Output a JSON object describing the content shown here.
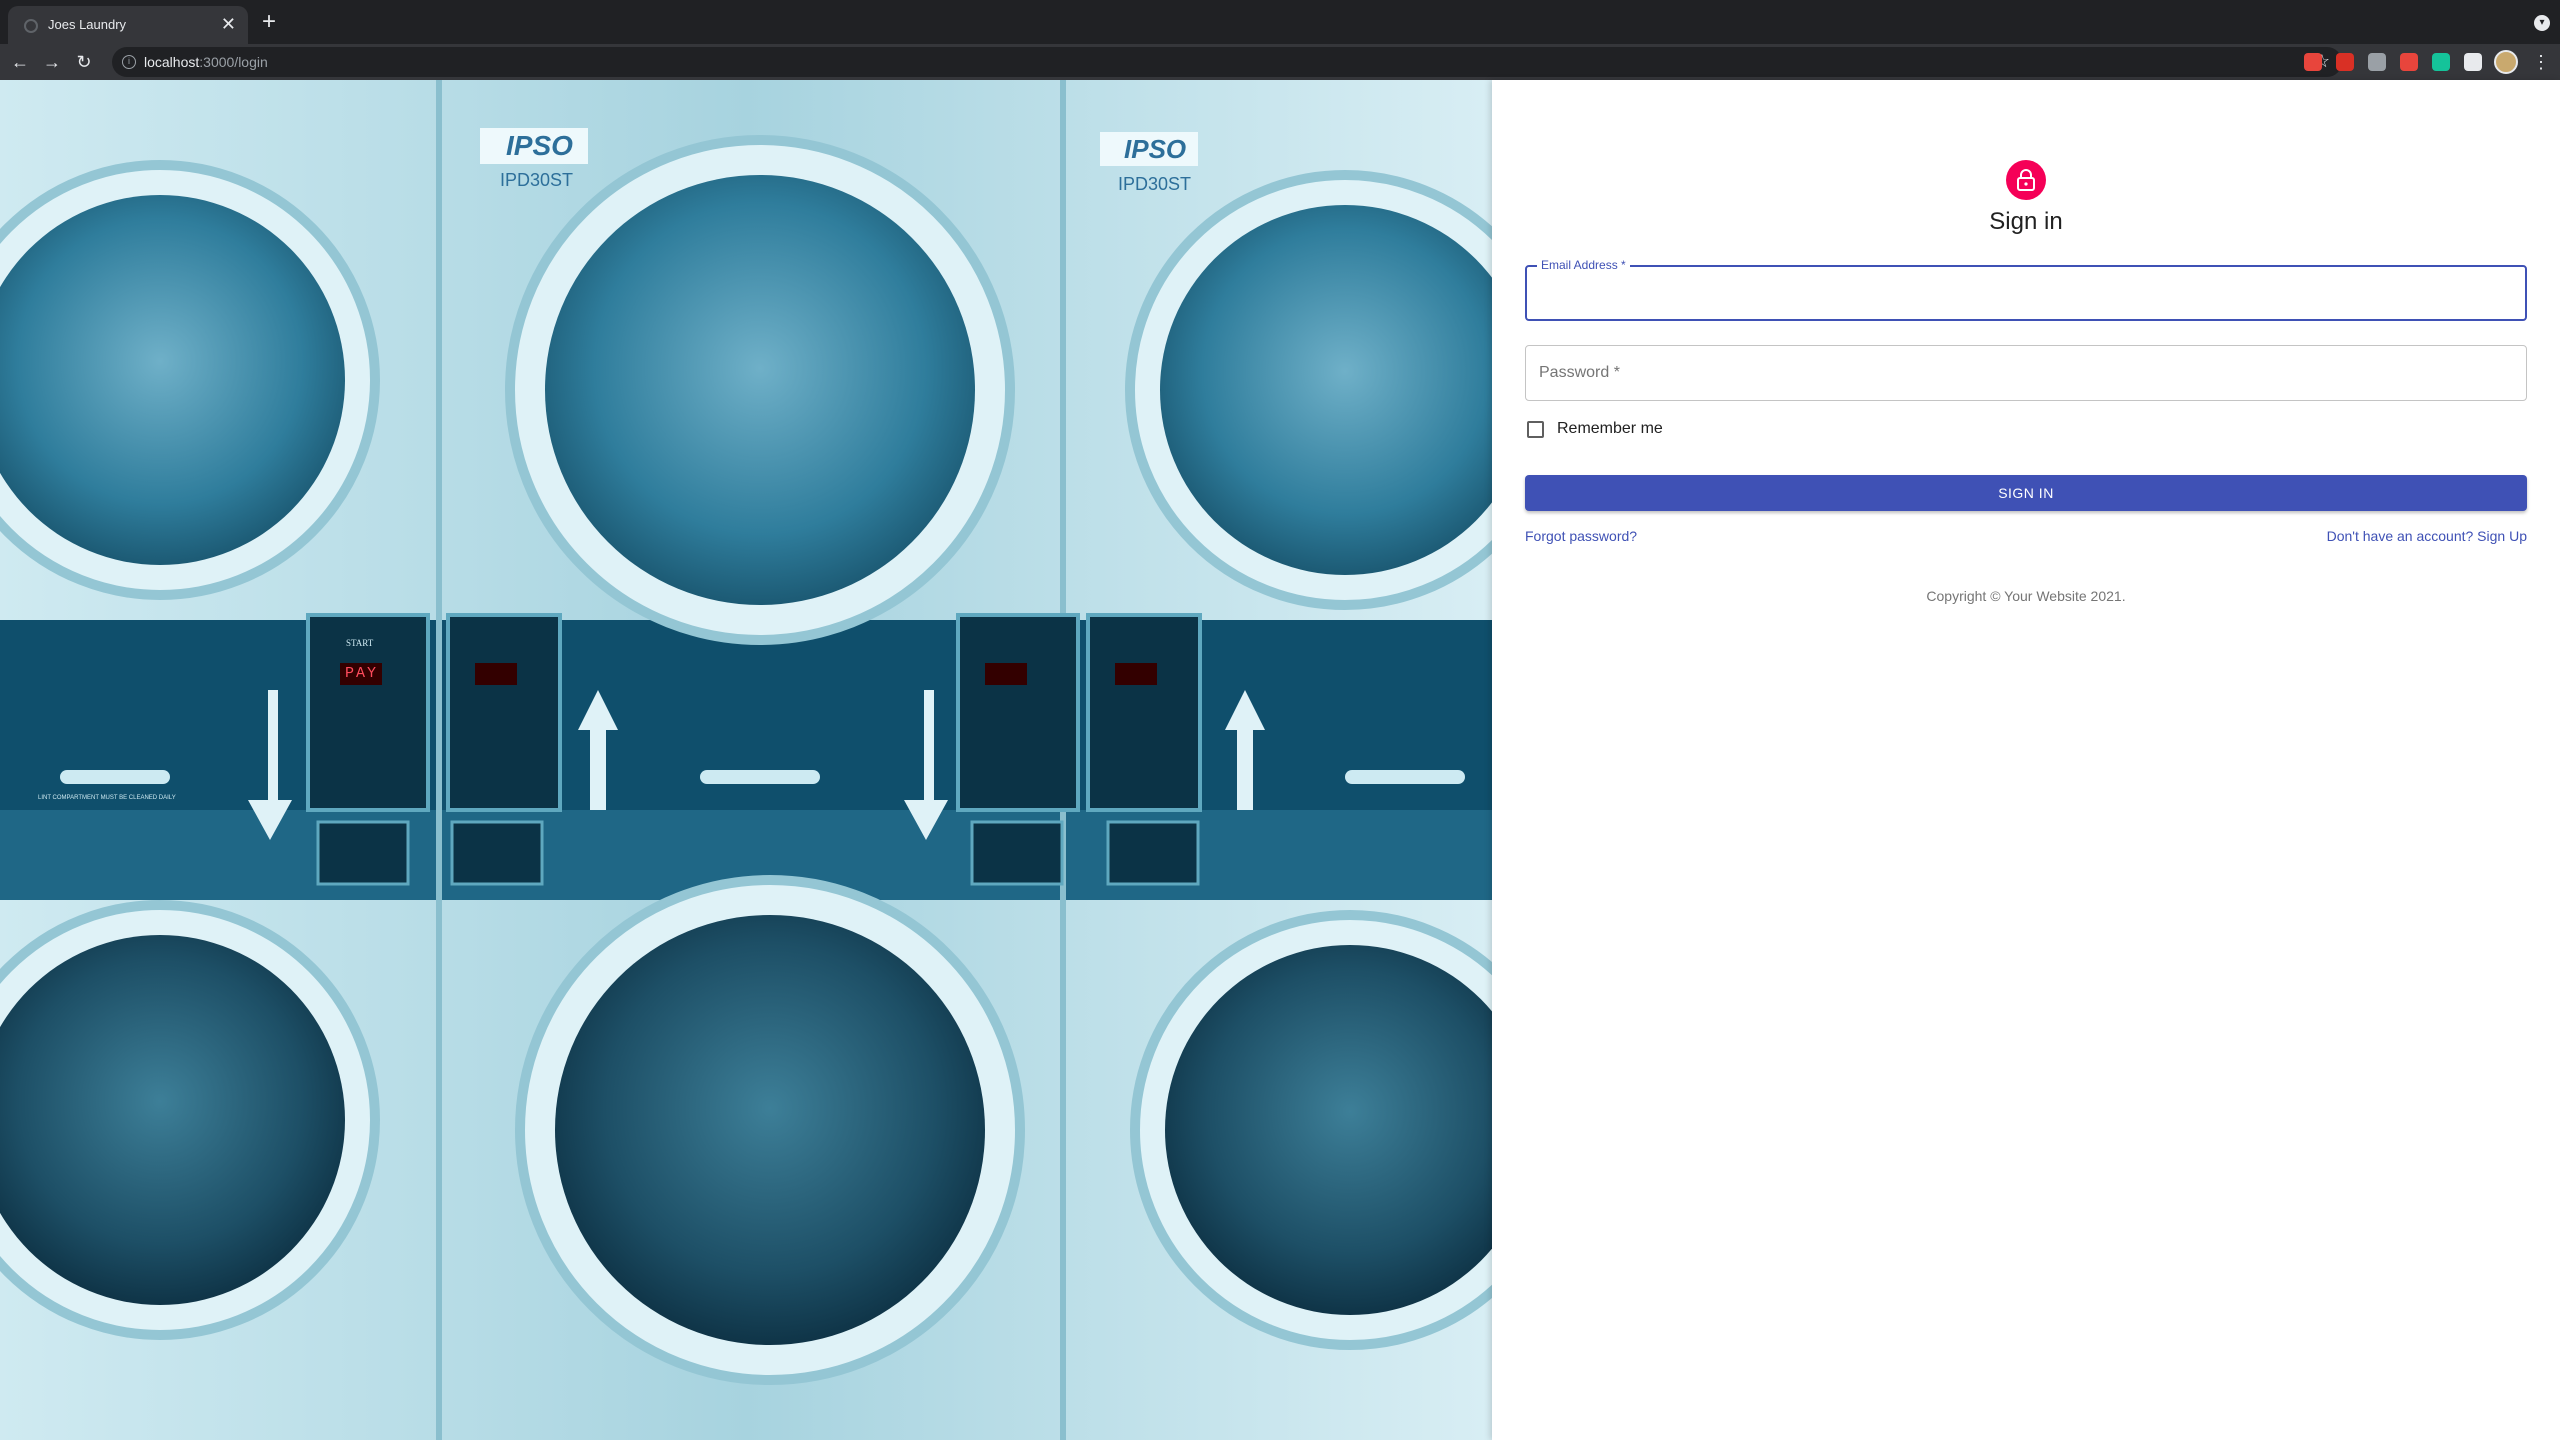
{
  "browser": {
    "tab_title": "Joes Laundry",
    "tab_close": "✕",
    "new_tab": "+",
    "url_host": "localhost",
    "url_path": ":3000/login",
    "back": "←",
    "forward": "→",
    "reload": "↻",
    "star": "☆",
    "menu": "⋮",
    "extensions": [
      {
        "name": "ext-red-icon",
        "color": "#e8453c"
      },
      {
        "name": "ext-calendar-icon",
        "color": "#d93025"
      },
      {
        "name": "ext-gray-icon",
        "color": "#9aa0a6"
      },
      {
        "name": "ext-flag-icon",
        "color": "#e8453c"
      },
      {
        "name": "ext-grammarly-icon",
        "color": "#15c39a"
      },
      {
        "name": "extensions-puzzle-icon",
        "color": "#e8eaed"
      }
    ]
  },
  "hero": {
    "machines": [
      {
        "brand": "IPSO",
        "model": "IPD30ST"
      },
      {
        "brand": "IPSO",
        "model": "IPD30ST"
      }
    ],
    "panel_label": "START",
    "display_text": "PAY",
    "lint_notice": "LINT COMPARTMENT MUST BE CLEANED DAILY"
  },
  "form": {
    "title": "Sign in",
    "email_label": "Email Address *",
    "password_label": "Password *",
    "remember_label": "Remember me",
    "submit_label": "SIGN IN",
    "forgot_link": "Forgot password?",
    "signup_link": "Don't have an account? Sign Up",
    "copyright": "Copyright © Your Website 2021."
  },
  "colors": {
    "primary": "#3f51b5",
    "avatar": "#f50057"
  }
}
